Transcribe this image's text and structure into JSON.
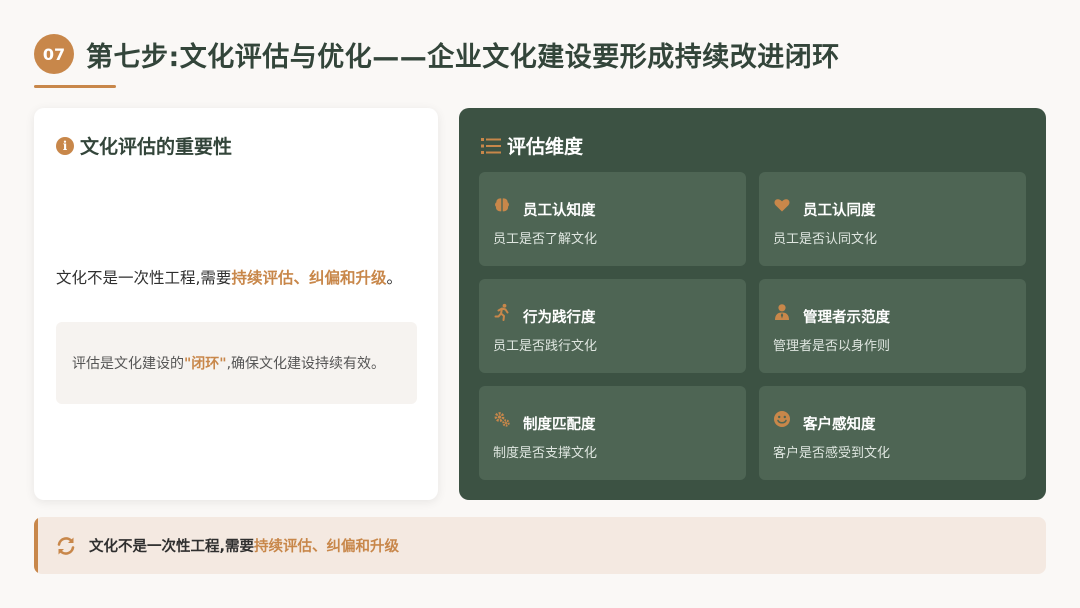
{
  "header": {
    "step_number": "07",
    "title": "第七步:文化评估与优化——企业文化建设要形成持续改进闭环"
  },
  "importance_card": {
    "heading": "文化评估的重要性",
    "lead_prefix": "文化不是一次性工程,需要",
    "lead_accent": "持续评估、纠偏和升级",
    "lead_suffix": "。",
    "quote_prefix": "评估是文化建设的",
    "quote_accent": "\"闭环\"",
    "quote_suffix": ",确保文化建设持续有效。"
  },
  "dimensions_panel": {
    "heading": "评估维度",
    "items": [
      {
        "icon": "brain-icon",
        "title": "员工认知度",
        "desc": "员工是否了解文化"
      },
      {
        "icon": "heart-icon",
        "title": "员工认同度",
        "desc": "员工是否认同文化"
      },
      {
        "icon": "running-person-icon",
        "title": "行为践行度",
        "desc": "员工是否践行文化"
      },
      {
        "icon": "manager-icon",
        "title": "管理者示范度",
        "desc": "管理者是否以身作则"
      },
      {
        "icon": "gears-icon",
        "title": "制度匹配度",
        "desc": "制度是否支撑文化"
      },
      {
        "icon": "smile-icon",
        "title": "客户感知度",
        "desc": "客户是否感受到文化"
      }
    ]
  },
  "footer": {
    "icon": "refresh-icon",
    "text_prefix": "文化不是一次性工程,需要",
    "text_accent": "持续评估、纠偏和升级"
  },
  "colors": {
    "accent": "#c8874a",
    "panel_green": "#3c5243",
    "tile_green": "#4e6554",
    "title_green": "#33453a"
  }
}
